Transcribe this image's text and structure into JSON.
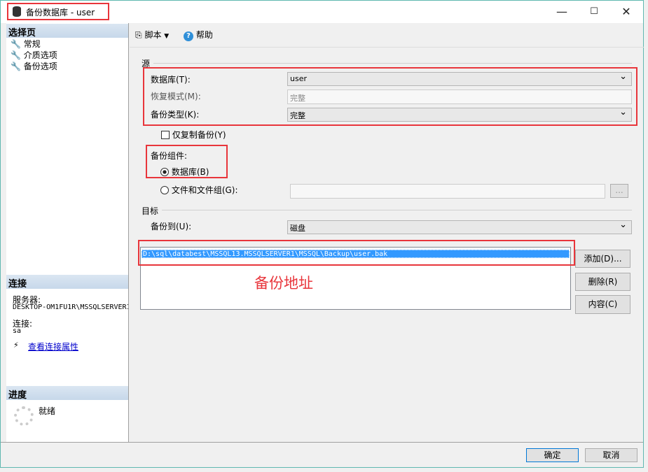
{
  "window": {
    "title": "备份数据库 - user",
    "min": "—",
    "max": "☐",
    "close": "✕"
  },
  "left": {
    "select_header": "选择页",
    "pages": [
      {
        "label": "常规"
      },
      {
        "label": "介质选项"
      },
      {
        "label": "备份选项"
      }
    ],
    "conn_header": "连接",
    "server_label": "服务器:",
    "server": "DESKTOP-OM1FU1R\\MSSQLSERVER1",
    "conn_label": "连接:",
    "conn": "sa",
    "view_link": "查看连接属性",
    "progress_header": "进度",
    "progress_status": "就绪"
  },
  "toolbar": {
    "script": "脚本",
    "help": "帮助"
  },
  "source": {
    "legend": "源",
    "db_label": "数据库(T):",
    "db_value": "user",
    "recovery_label": "恢复模式(M):",
    "recovery_value": "完整",
    "type_label": "备份类型(K):",
    "type_value": "完整",
    "copy_only": "仅复制备份(Y)",
    "component_label": "备份组件:",
    "comp_db": "数据库(B)",
    "comp_files": "文件和文件组(G):",
    "browse": "..."
  },
  "target": {
    "legend": "目标",
    "to_label": "备份到(U):",
    "to_value": "磁盘",
    "paths": [
      "D:\\sql\\databest\\MSSQL13.MSSQLSERVER1\\MSSQL\\Backup\\user.bak"
    ],
    "add": "添加(D)...",
    "remove": "删除(R)",
    "contents": "内容(C)",
    "annotation": "备份地址"
  },
  "footer": {
    "ok": "确定",
    "cancel": "取消"
  },
  "colors": {
    "highlight": "#e8353b",
    "selection": "#3399ff"
  }
}
